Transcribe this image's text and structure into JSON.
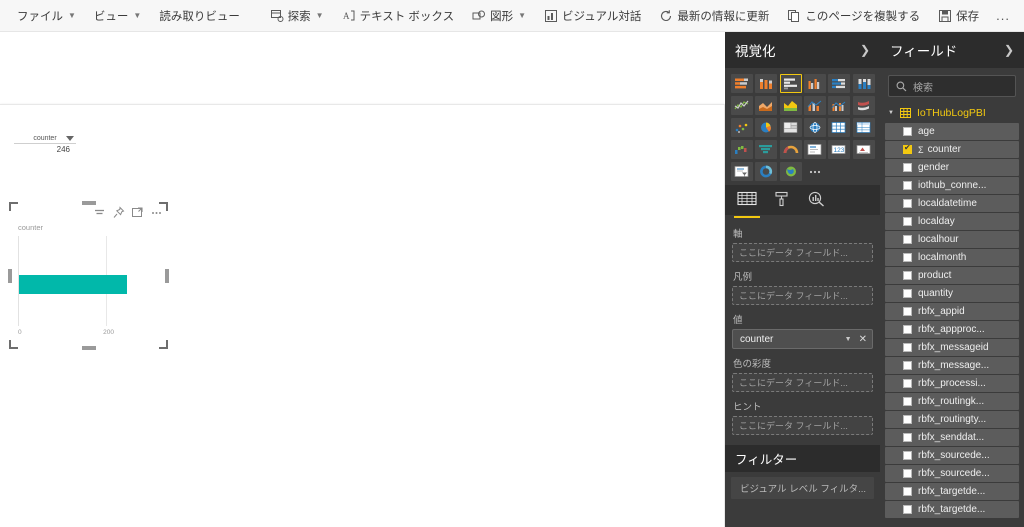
{
  "toolbar": {
    "left_items": [
      {
        "label": "ファイル",
        "caret": true,
        "icon": null
      },
      {
        "label": "ビュー",
        "caret": true,
        "icon": null
      },
      {
        "label": "読み取りビュー",
        "caret": false,
        "icon": null
      }
    ],
    "right_items": [
      {
        "label": "探索",
        "caret": true,
        "icon": "explore-icon"
      },
      {
        "label": "テキスト ボックス",
        "caret": false,
        "icon": "textbox-icon"
      },
      {
        "label": "図形",
        "caret": true,
        "icon": "shapes-icon"
      },
      {
        "label": "ビジュアル対話",
        "caret": false,
        "icon": "visual-interactions-icon"
      },
      {
        "label": "最新の情報に更新",
        "caret": false,
        "icon": "refresh-icon"
      },
      {
        "label": "このページを複製する",
        "caret": false,
        "icon": "duplicate-page-icon"
      },
      {
        "label": "保存",
        "caret": false,
        "icon": "save-icon"
      }
    ],
    "overflow_label": "..."
  },
  "canvas": {
    "card_visual": {
      "label": "counter",
      "value": "246"
    },
    "chart_visual": {
      "title": "counter",
      "header_icons": [
        "filter-icon",
        "pin-icon",
        "focus-mode-icon",
        "more-options-icon"
      ]
    }
  },
  "chart_data": {
    "type": "bar",
    "orientation": "horizontal",
    "title": "counter",
    "categories": [
      "counter"
    ],
    "values": [
      246
    ],
    "series": [
      {
        "name": "counter",
        "values": [
          246
        ]
      }
    ],
    "xlabel": "",
    "ylabel": "",
    "xticks": [
      "0",
      "200"
    ],
    "xlim": [
      0,
      325
    ],
    "grid": true,
    "legend": "none",
    "bar_color": "#01b8aa"
  },
  "visualizations": {
    "title": "視覚化",
    "collapse_icon": "chevron-right-icon",
    "gallery": [
      {
        "name": "stacked-bar-chart",
        "selected": false
      },
      {
        "name": "stacked-column-chart",
        "selected": false
      },
      {
        "name": "clustered-bar-chart",
        "selected": true
      },
      {
        "name": "clustered-column-chart",
        "selected": false
      },
      {
        "name": "100-stacked-bar-chart",
        "selected": false
      },
      {
        "name": "100-stacked-column-chart",
        "selected": false
      },
      {
        "name": "line-chart",
        "selected": false
      },
      {
        "name": "area-chart",
        "selected": false
      },
      {
        "name": "stacked-area-chart",
        "selected": false
      },
      {
        "name": "line-stacked-column-chart",
        "selected": false
      },
      {
        "name": "line-clustered-column-chart",
        "selected": false
      },
      {
        "name": "ribbon-chart",
        "selected": false
      },
      {
        "name": "scatter-chart",
        "selected": false
      },
      {
        "name": "pie-chart",
        "selected": false
      },
      {
        "name": "treemap",
        "selected": false
      },
      {
        "name": "map",
        "selected": false
      },
      {
        "name": "matrix",
        "selected": false
      },
      {
        "name": "table",
        "selected": false
      },
      {
        "name": "waterfall-chart",
        "selected": false
      },
      {
        "name": "funnel-chart",
        "selected": false
      },
      {
        "name": "gauge-chart",
        "selected": false
      },
      {
        "name": "multi-row-card",
        "selected": false
      },
      {
        "name": "card",
        "selected": false
      },
      {
        "name": "kpi",
        "selected": false
      },
      {
        "name": "slicer",
        "selected": false
      },
      {
        "name": "donut-chart",
        "selected": false
      },
      {
        "name": "filled-map",
        "selected": false
      },
      {
        "name": "more-visuals",
        "selected": false
      }
    ],
    "tabs": [
      {
        "name": "fields-tab",
        "icon": "fields-grid-icon",
        "active": true
      },
      {
        "name": "format-tab",
        "icon": "paint-roller-icon",
        "active": false
      },
      {
        "name": "analytics-tab",
        "icon": "magnifier-chart-icon",
        "active": false
      }
    ],
    "buckets": [
      {
        "label": "軸",
        "placeholder": "ここにデータ フィールド...",
        "value": null
      },
      {
        "label": "凡例",
        "placeholder": "ここにデータ フィールド...",
        "value": null
      },
      {
        "label": "値",
        "placeholder": null,
        "value": "counter"
      },
      {
        "label": "色の彩度",
        "placeholder": "ここにデータ フィールド...",
        "value": null
      },
      {
        "label": "ヒント",
        "placeholder": "ここにデータ フィールド...",
        "value": null
      }
    ],
    "filters": {
      "title": "フィルター",
      "rows": [
        "ビジュアル レベル フィルタ..."
      ]
    }
  },
  "fields": {
    "title": "フィールド",
    "collapse_icon": "chevron-right-icon",
    "search": {
      "placeholder": "検索",
      "value": "",
      "icon": "search-icon"
    },
    "table": {
      "name": "IoTHubLogPBI",
      "expanded": true,
      "icon": "table-icon"
    },
    "items": [
      {
        "label": "age",
        "checked": false,
        "measure": false
      },
      {
        "label": "counter",
        "checked": true,
        "measure": true
      },
      {
        "label": "gender",
        "checked": false,
        "measure": false
      },
      {
        "label": "iothub_conne...",
        "checked": false,
        "measure": false
      },
      {
        "label": "localdatetime",
        "checked": false,
        "measure": false
      },
      {
        "label": "localday",
        "checked": false,
        "measure": false
      },
      {
        "label": "localhour",
        "checked": false,
        "measure": false
      },
      {
        "label": "localmonth",
        "checked": false,
        "measure": false
      },
      {
        "label": "product",
        "checked": false,
        "measure": false
      },
      {
        "label": "quantity",
        "checked": false,
        "measure": false
      },
      {
        "label": "rbfx_appid",
        "checked": false,
        "measure": false
      },
      {
        "label": "rbfx_appproc...",
        "checked": false,
        "measure": false
      },
      {
        "label": "rbfx_messageid",
        "checked": false,
        "measure": false
      },
      {
        "label": "rbfx_message...",
        "checked": false,
        "measure": false
      },
      {
        "label": "rbfx_processi...",
        "checked": false,
        "measure": false
      },
      {
        "label": "rbfx_routingk...",
        "checked": false,
        "measure": false
      },
      {
        "label": "rbfx_routingty...",
        "checked": false,
        "measure": false
      },
      {
        "label": "rbfx_senddat...",
        "checked": false,
        "measure": false
      },
      {
        "label": "rbfx_sourcede...",
        "checked": false,
        "measure": false
      },
      {
        "label": "rbfx_sourcede...",
        "checked": false,
        "measure": false
      },
      {
        "label": "rbfx_targetde...",
        "checked": false,
        "measure": false
      },
      {
        "label": "rbfx_targetde...",
        "checked": false,
        "measure": false
      }
    ]
  },
  "colors": {
    "accent": "#f2c811",
    "bar": "#01b8aa",
    "pane_bg": "#3b3b3b",
    "pane_header_bg": "#2c2c2c"
  }
}
